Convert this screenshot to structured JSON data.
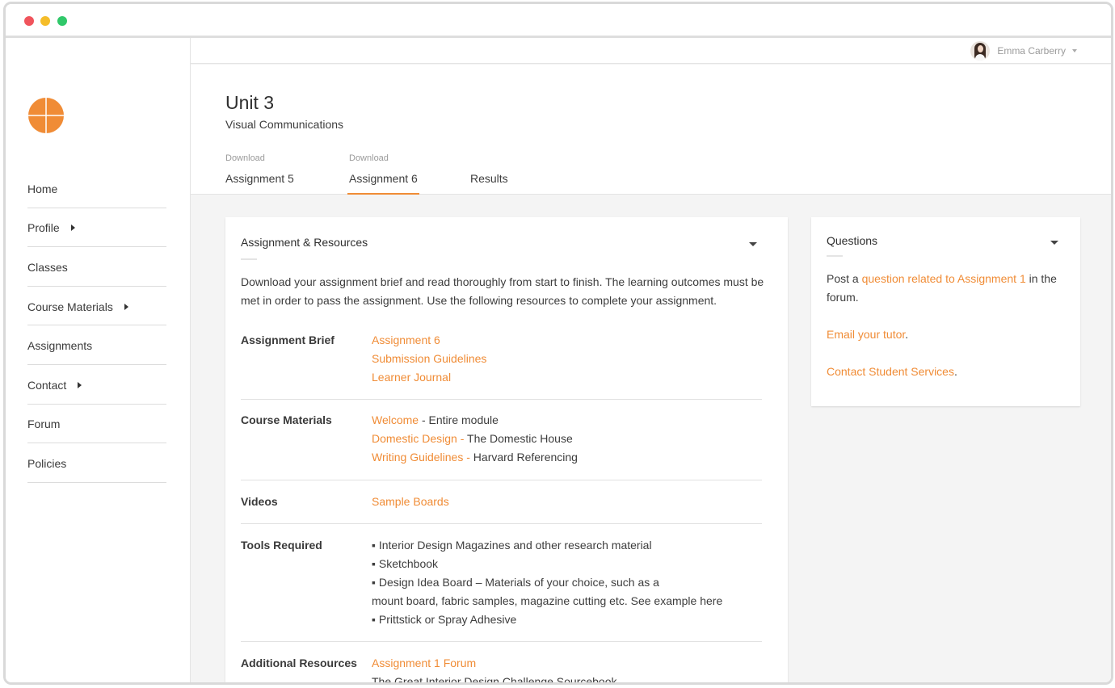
{
  "window": {
    "colors": {
      "close": "#f0545c",
      "minimize": "#f5bd2a",
      "maximize": "#30c86a",
      "accent": "#f08c36"
    }
  },
  "sidebar": {
    "logo_icon": "orange-quartered-circle",
    "items": [
      {
        "label": "Home",
        "has_submenu": false
      },
      {
        "label": "Profile",
        "has_submenu": true
      },
      {
        "label": "Classes",
        "has_submenu": false
      },
      {
        "label": "Course Materials",
        "has_submenu": true
      },
      {
        "label": "Assignments",
        "has_submenu": false
      },
      {
        "label": "Contact",
        "has_submenu": true
      },
      {
        "label": "Forum",
        "has_submenu": false
      },
      {
        "label": "Policies",
        "has_submenu": false
      }
    ]
  },
  "topbar": {
    "user_name": "Emma Carberry"
  },
  "header": {
    "title": "Unit 3",
    "subtitle": "Visual Communications",
    "tabs": [
      {
        "pre": "Download",
        "label": "Assignment 5"
      },
      {
        "pre": "Download",
        "label": "Assignment 6",
        "active": true
      },
      {
        "pre": "",
        "label": "Results"
      }
    ]
  },
  "resources": {
    "heading": "Assignment & Resources",
    "intro": "Download your assignment brief and read thoroughly from start to finish. The learning outcomes must be met in order to pass the assignment. Use the following resources to complete your assignment.",
    "brief": {
      "label": "Assignment Brief",
      "links": [
        "Assignment 6",
        "Submission Guidelines",
        "Learner Journal"
      ]
    },
    "materials": {
      "label": "Course Materials",
      "items": [
        {
          "link": "Welcome",
          "text": " - Entire module"
        },
        {
          "link": "Domestic Design - ",
          "text": "The Domestic House"
        },
        {
          "link": "Writing Guidelines - ",
          "text": "Harvard Referencing"
        }
      ]
    },
    "videos": {
      "label": "Videos",
      "link": "Sample Boards"
    },
    "tools": {
      "label": "Tools Required",
      "lines": [
        "▪ Interior Design Magazines and other research material",
        "▪ Sketchbook",
        "▪ Design Idea Board – Materials of your choice, such as a",
        "mount board, fabric samples, magazine cutting etc. See example here",
        "▪ Prittstick or Spray Adhesive"
      ]
    },
    "additional": {
      "label": "Additional Resources",
      "link": "Assignment 1 Forum",
      "text": "The Great Interior Design Challenge Sourcebook"
    }
  },
  "questions": {
    "heading": "Questions",
    "post_prefix": "Post a ",
    "post_link": "question related to Assignment 1",
    "post_suffix": " in the forum.",
    "email_link": "Email your tutor",
    "email_suffix": ".",
    "contact_link": "Contact Student Services",
    "contact_suffix": "."
  }
}
